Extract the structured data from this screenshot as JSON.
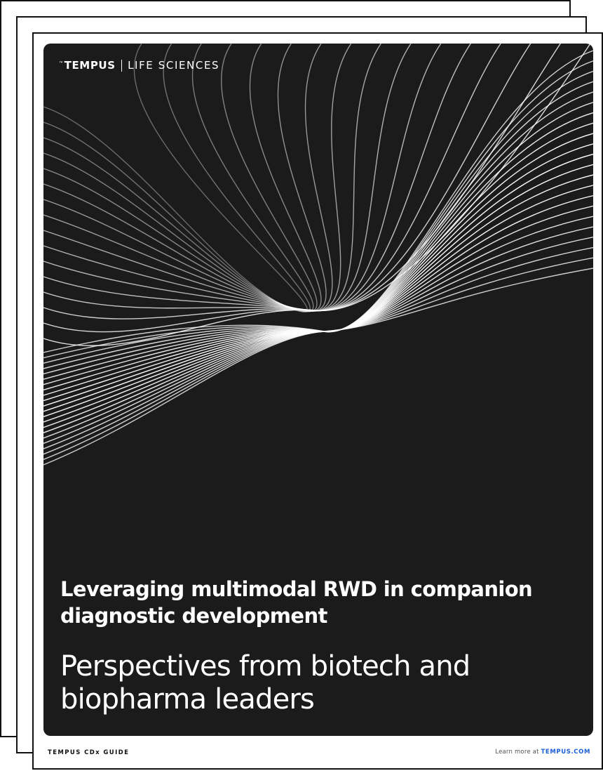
{
  "brand": {
    "logo": "TEMPUS",
    "trademark": "™",
    "division": "LIFE SCIENCES"
  },
  "document": {
    "subtitle": "Leveraging multimodal RWD in companion diagnostic development",
    "title": "Perspectives from biotech and biopharma leaders"
  },
  "footer": {
    "guide_label": "TEMPUS CDx GUIDE",
    "learn_more_text": "Learn more at",
    "link_text": "TEMPUS.COM"
  },
  "colors": {
    "cover_background": "#1b1b1b",
    "text_on_cover": "#ffffff",
    "link": "#1a5fd6"
  },
  "icons": {
    "brand_separator": "vertical-bar"
  }
}
